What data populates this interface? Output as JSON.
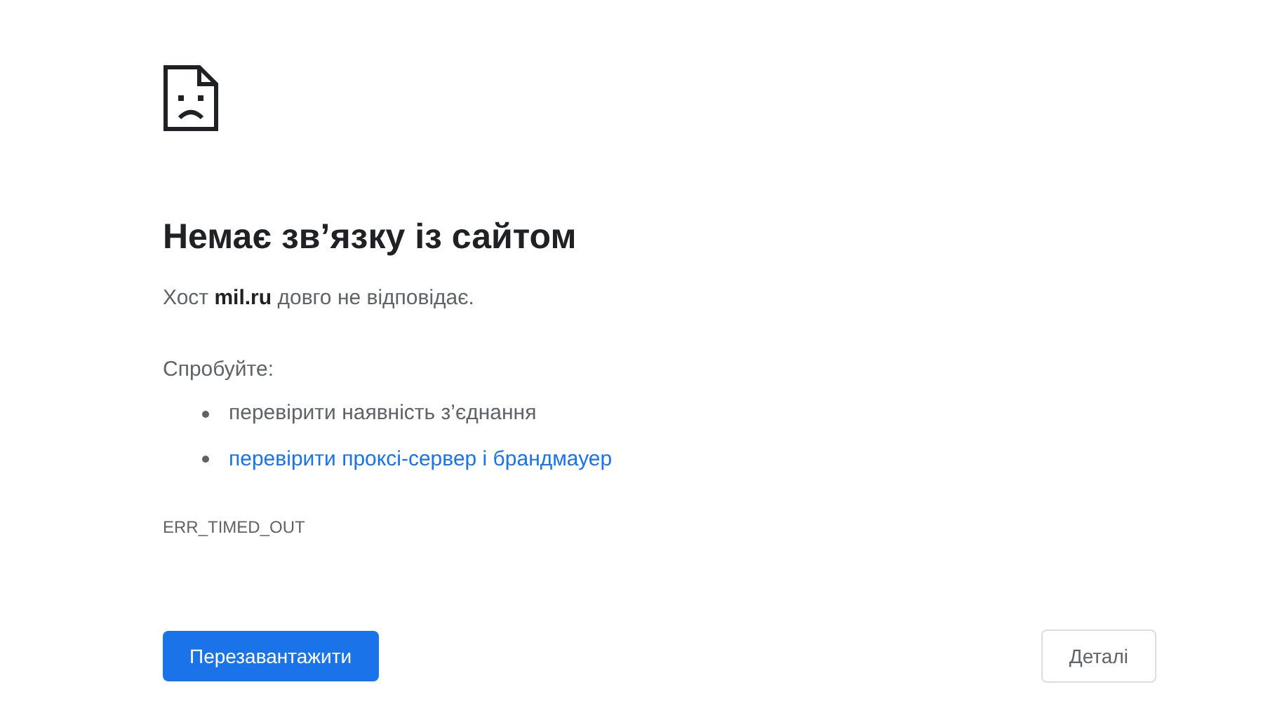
{
  "title": "Немає зв’язку із сайтом",
  "message": "Хост **mil.ru** довго не відповідає.",
  "suggestions_heading": "Спробуйте:",
  "suggestions": [
    {
      "text": "перевірити наявність з’єднання",
      "kind": "text"
    },
    {
      "text": "перевірити проксі-сервер і брандмауер",
      "kind": "link"
    }
  ],
  "error_code": "ERR_TIMED_OUT",
  "buttons": [
    {
      "label": "Перезавантажити",
      "kind": "primary"
    },
    {
      "label": "Деталі",
      "kind": "secondary"
    }
  ]
}
